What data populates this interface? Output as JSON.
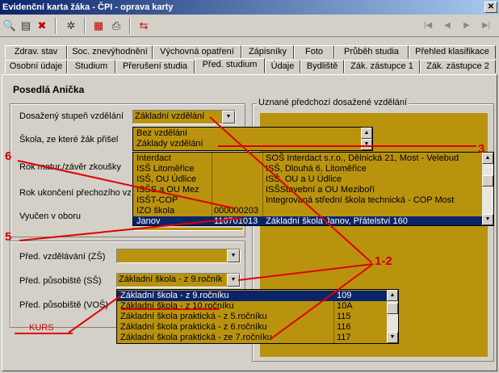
{
  "window": {
    "title": "Evidenční karta žáka - ČPI - oprava karty",
    "close_glyph": "✕"
  },
  "toolbar": {
    "icons": [
      "find-icon",
      "copy-icon",
      "delete-icon",
      "gear-icon",
      "paste-icon",
      "print-icon",
      "swap-icon"
    ],
    "nav": {
      "first": "|◀",
      "prev": "◀",
      "next": "▶",
      "last": "▶|"
    }
  },
  "tabs": {
    "row1": [
      "Zdrav. stav",
      "Soc. znevýhodnění",
      "Výchovná opatření",
      "Zápisníky",
      "Foto",
      "Průběh studia",
      "Přehled klasifikace"
    ],
    "row2": [
      "Osobní údaje",
      "Studium",
      "Přerušení studia",
      "Před. studium",
      "Údaje",
      "Bydliště",
      "Zák. zástupce 1",
      "Zák. zástupce 2"
    ]
  },
  "student_name": "Posedlá Anička",
  "form": {
    "dosazeny_label": "Dosažený stupeň vzdělání",
    "dosazeny_value": "Základní vzdělání",
    "skola_label": "Škola, ze které žák přišel",
    "rok_maturita_label": "Rok matur./závěr zkoušky",
    "rok_ukonceni_label": "Rok ukončení přechozího vz",
    "vyucen_label": "Vyučen v oboru",
    "pred_vzdelavani_label": "Před. vzdělávání (ZŠ)",
    "pred_pusobiste_ss_label": "Před. působiště (SŠ)",
    "pred_pusobiste_ss_value": "Základní škola - z 9.ročník",
    "pred_pusobiste_vos_label": "Před. působiště (VOŠ)",
    "uznane_title": "Uznané předchozí dosažené vzdělání"
  },
  "dropdown_vzdelani": [
    "Bez vzdělání",
    "Základy vzdělání"
  ],
  "dropdown_skola": [
    {
      "a": "Interdact",
      "b": "",
      "c": "SOŠ Interdact s.r.o., Dělnická 21, Most - Velebud"
    },
    {
      "a": "ISŠ Litoměřice",
      "b": "",
      "c": "ISŠ, Dlouhá 6, Litoměřice"
    },
    {
      "a": "ISŠ, OU Údlice",
      "b": "",
      "c": "ISŠ, OU a U Údlice"
    },
    {
      "a": "ISŠS a OU Mez",
      "b": "",
      "c": "ISŠStavební a OU Meziboří"
    },
    {
      "a": "ISŠT-COP",
      "b": "",
      "c": "Integrovaná střední škola technická - COP Most"
    },
    {
      "a": "IZO škola",
      "b": "000000203",
      "c": ""
    },
    {
      "a": "Janov",
      "b": "116701013",
      "c": "Základní škola Janov, Přátelství 160"
    }
  ],
  "dropdown_pusobiste": [
    {
      "name": "Základní škola - z 9.ročníku",
      "code": "109"
    },
    {
      "name": "Základní škola - z 10.ročníku",
      "code": "10A"
    },
    {
      "name": "Základní škola praktická - z 5.ročníku",
      "code": "115"
    },
    {
      "name": "Základní škola praktická - z 6.ročníku",
      "code": "116"
    },
    {
      "name": "Základní škola praktická - ze 7.ročníku",
      "code": "117"
    }
  ],
  "annotations": {
    "n3": "3",
    "n6": "6",
    "n5": "5",
    "n12": "1-2",
    "kurs": "KURS"
  },
  "colors": {
    "field_yellow": "#b9930d",
    "selection": "#0a246a",
    "annotation_red": "#d00000"
  }
}
